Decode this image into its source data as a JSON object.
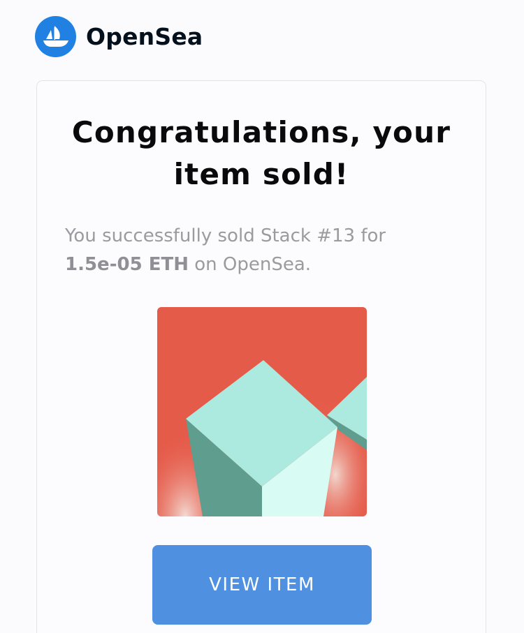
{
  "header": {
    "brand_name": "OpenSea",
    "logo_icon": "opensea-ship-icon",
    "logo_color": "#2081E2"
  },
  "card": {
    "headline_line1": "Congratulations, your",
    "headline_line2": "item sold!",
    "message": {
      "prefix": "You successfully sold Stack #13 for",
      "price": "1.5e-05 ETH",
      "suffix": " on OpenSea."
    },
    "item_image": {
      "icon": "stack-cubes-artwork",
      "background_color": "#E55B4A",
      "cube_color": "#ACE9DF"
    },
    "view_item_label": "VIEW ITEM",
    "button_color": "#5090E0"
  }
}
